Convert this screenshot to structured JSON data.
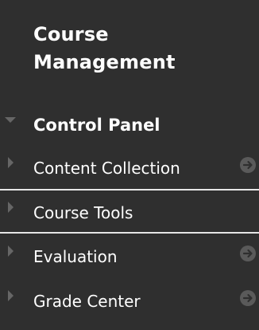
{
  "panel": {
    "title": "Course Management",
    "section": {
      "label": "Control Panel",
      "expanded": true
    },
    "items": [
      {
        "label": "Content Collection",
        "has_go_icon": true,
        "highlighted": false
      },
      {
        "label": "Course Tools",
        "has_go_icon": false,
        "highlighted": true
      },
      {
        "label": "Evaluation",
        "has_go_icon": true,
        "highlighted": false
      },
      {
        "label": "Grade Center",
        "has_go_icon": true,
        "highlighted": false
      }
    ]
  },
  "colors": {
    "background": "#2f2f2f",
    "text": "#ffffff",
    "triangle": "#666666",
    "go_icon": "#5a5a5a",
    "divider": "#e6e6e6"
  },
  "icons": {
    "collapse": "triangle-down-icon",
    "expand": "triangle-right-icon",
    "go": "arrow-circle-right-icon"
  }
}
